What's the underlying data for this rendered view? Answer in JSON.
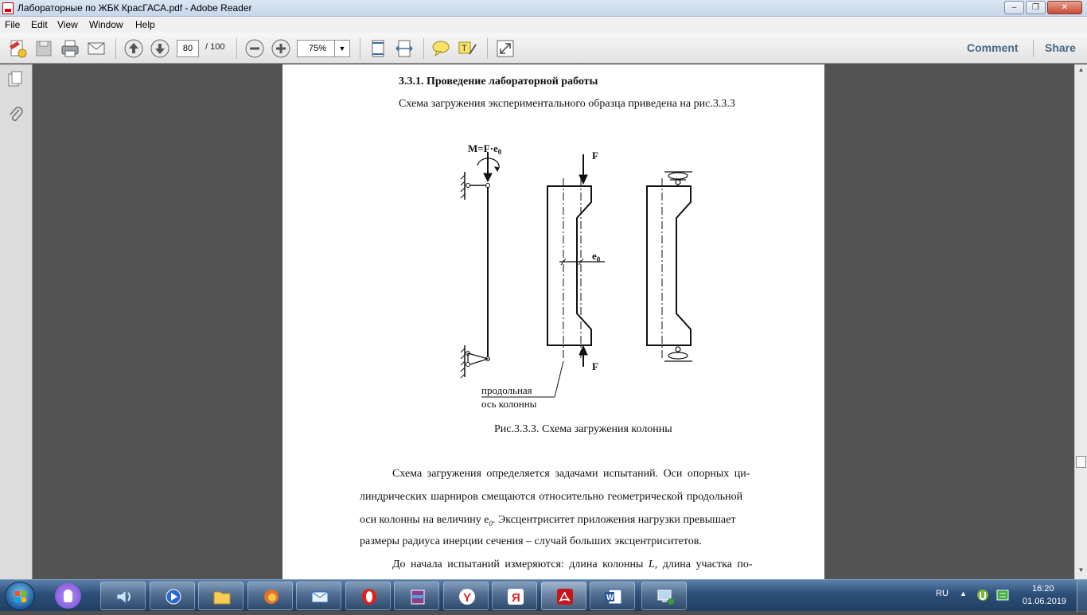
{
  "window": {
    "title": "Лабораторные по ЖБК КрасГАСА.pdf - Adobe Reader"
  },
  "menu": [
    "File",
    "Edit",
    "View",
    "Window",
    "Help"
  ],
  "toolbar": {
    "current_page": "80",
    "page_total": "/ 100",
    "zoom": "75%",
    "comment_label": "Comment",
    "share_label": "Share"
  },
  "document": {
    "section_heading": "3.3.1. Проведение лабораторной работы",
    "intro_line": "Схема загружения экспериментального образца приведена на рис.3.3.3",
    "figure_labels": {
      "moment": "M=F·e",
      "moment_sub": "0",
      "force_top": "F",
      "force_bottom": "F",
      "eccentricity": "e",
      "eccentricity_sub": "0",
      "axis_label_line1": "продольная",
      "axis_label_line2": "ось колонны"
    },
    "figure_caption": "Рис.3.3.3.  Схема загружения колонны",
    "para1": [
      "Схема загружения определяется задачами испытаний. Оси опорных ци-",
      "линдрических шарниров смещаются относительно геометрической продольной",
      "оси колонны на величину e",
      "0",
      ". Эксцентриситет приложения нагрузки превышает",
      "размеры радиуса инерции сечения – случай больших эксцентриситетов."
    ],
    "para2_line1": "До начала испытаний измеряются: длина колонны ",
    "para2_L": "L",
    "para2_rest": ", длина участка по-"
  },
  "taskbar": {
    "language": "RU",
    "time": "16:20",
    "date": "01.06.2019",
    "apps": [
      "alice-icon",
      "volume-app-icon",
      "media-icon",
      "explorer-folder-icon",
      "firefox-like-icon",
      "mail-icon",
      "opera-icon",
      "winrar-icon",
      "yandex-browser-icon",
      "yandex-icon",
      "acrobat-icon",
      "word-icon",
      "network-icon"
    ]
  }
}
